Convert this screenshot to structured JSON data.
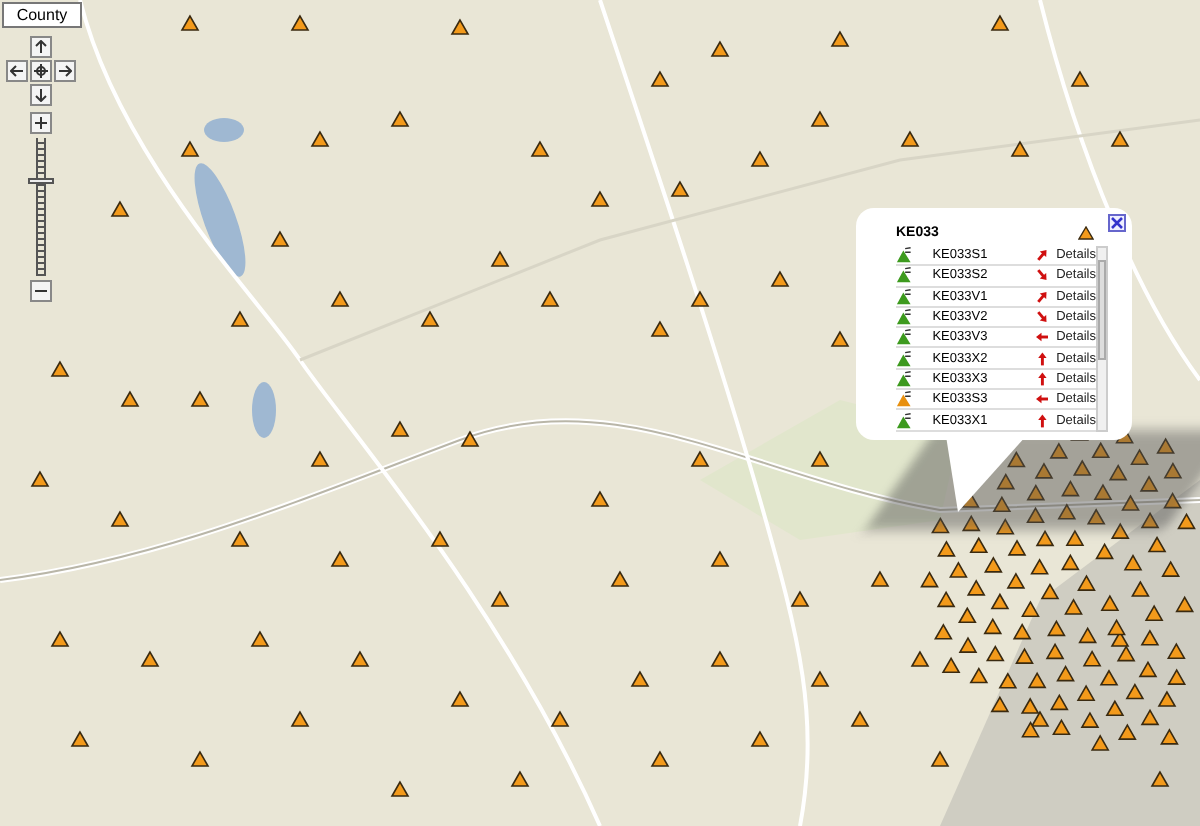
{
  "map_type_button": "County",
  "zoom": {
    "level": 0.7
  },
  "popup": {
    "title": "KE033",
    "rows": [
      {
        "name": "KE033S1",
        "color": "#3d9a1e",
        "kind": "northeast",
        "link": "Details"
      },
      {
        "name": "KE033S2",
        "color": "#3d9a1e",
        "kind": "southeast",
        "link": "Details"
      },
      {
        "name": "KE033V1",
        "color": "#3d9a1e",
        "kind": "northeast",
        "link": "Details"
      },
      {
        "name": "KE033V2",
        "color": "#3d9a1e",
        "kind": "southeast",
        "link": "Details"
      },
      {
        "name": "KE033V3",
        "color": "#3d9a1e",
        "kind": "west",
        "link": "Details"
      },
      {
        "name": "KE033X2",
        "color": "#3d9a1e",
        "kind": "north",
        "link": "Details"
      },
      {
        "name": "KE033X3",
        "color": "#3d9a1e",
        "kind": "north",
        "link": "Details"
      },
      {
        "name": "KE033S3",
        "color": "#e8900f",
        "kind": "west",
        "link": "Details"
      },
      {
        "name": "KE033X1",
        "color": "#3d9a1e",
        "kind": "north",
        "link": "Details"
      }
    ]
  }
}
